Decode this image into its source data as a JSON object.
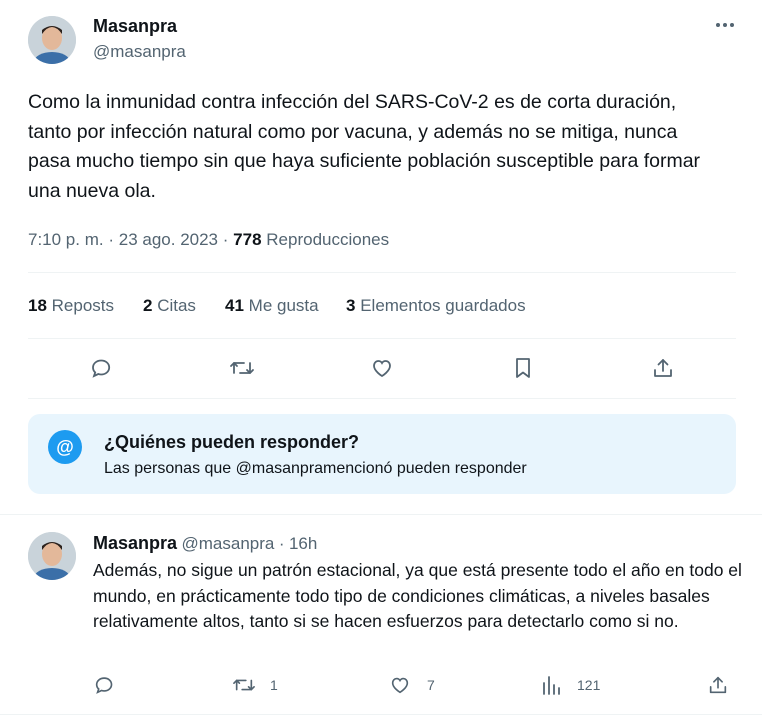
{
  "main_tweet": {
    "author_name": "Masanpra",
    "author_handle": "@masanpra",
    "more_icon": "more-horizontal-icon",
    "text": "Como la inmunidad contra infección del SARS-CoV-2 es de corta duración, tanto por infección natural como por vacuna, y además no se mitiga, nunca pasa mucho tiempo sin que haya suficiente población susceptible para formar una nueva ola.",
    "time": "7:10 p. m.",
    "date": "23 ago. 2023",
    "separator": "·",
    "views_count": "778",
    "views_label": "Reproducciones",
    "stats": [
      {
        "count": "18",
        "label": "Reposts"
      },
      {
        "count": "2",
        "label": "Citas"
      },
      {
        "count": "41",
        "label": "Me gusta"
      },
      {
        "count": "3",
        "label": "Elementos guardados"
      }
    ],
    "actions": [
      "reply-icon",
      "retweet-icon",
      "like-icon",
      "bookmark-icon",
      "share-icon"
    ]
  },
  "reply_notice": {
    "icon": "at-icon",
    "icon_text": "@",
    "title": "¿Quiénes pueden responder?",
    "subtitle": "Las personas que @masanpramencionó pueden responder"
  },
  "reply_tweet": {
    "author_name": "Masanpra",
    "author_handle": "@masanpra",
    "time_ago": "16h",
    "separator": "·",
    "text": "Además, no sigue un patrón estacional, ya que está presente todo el año en todo el mundo, en prácticamente todo tipo de condiciones climáticas, a niveles basales relativamente altos, tanto si se hacen esfuerzos para detectarlo como si no.",
    "reply_count": "",
    "retweet_count": "1",
    "like_count": "7",
    "views_count": "121",
    "actions": [
      "reply-icon",
      "retweet-icon",
      "like-icon",
      "views-icon",
      "share-icon"
    ]
  },
  "colors": {
    "text": "#0f1419",
    "secondary": "#536471",
    "accent": "#1d9bf0",
    "notice_bg": "#e8f5fd",
    "divider": "#eff3f4"
  }
}
